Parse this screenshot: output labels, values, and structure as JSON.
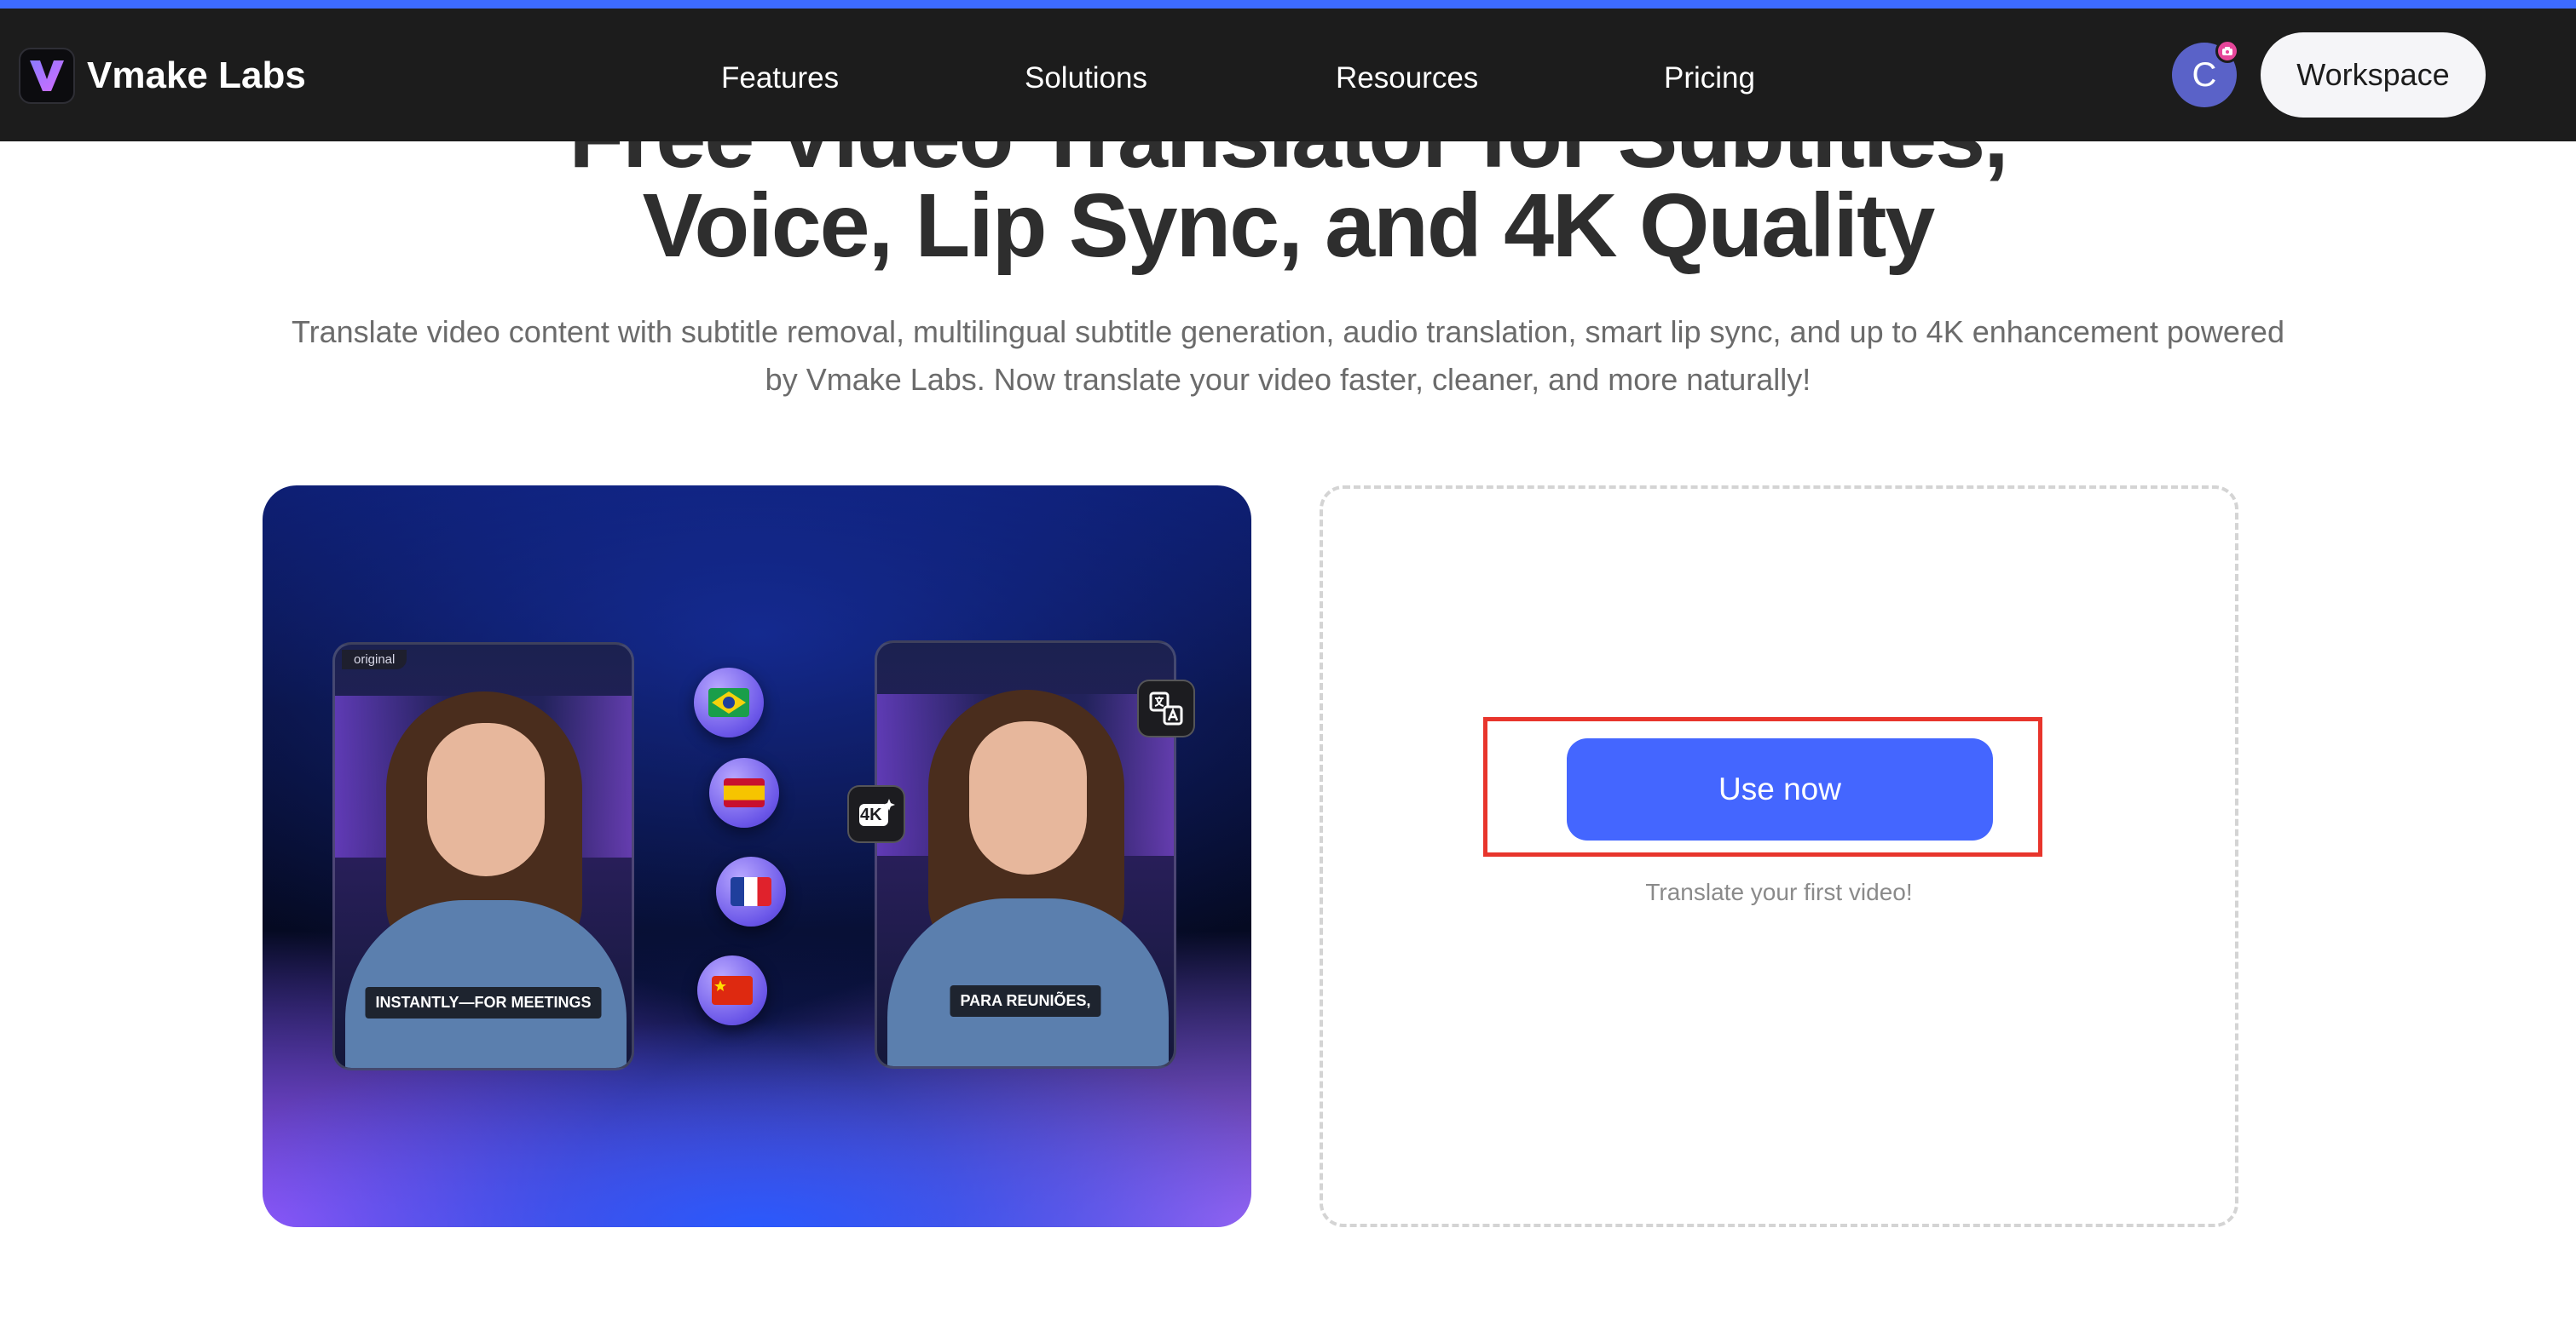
{
  "brand": {
    "name": "Vmake Labs",
    "accent_color": "#3d6bff",
    "button_color": "#4466ff"
  },
  "nav": {
    "links": [
      "Features",
      "Solutions",
      "Resources",
      "Pricing"
    ],
    "avatar_letter": "C",
    "workspace_label": "Workspace"
  },
  "hero": {
    "title_line1": "Free Video Translator for Subtitles,",
    "title_line2": "Voice, Lip Sync, and 4K Quality",
    "subtitle": "Translate video content with subtitle removal, multilingual subtitle generation, audio translation, smart lip sync, and up to 4K enhancement powered by Vmake Labs. Now translate your video faster, cleaner, and more naturally!"
  },
  "demo": {
    "original_tag": "original",
    "caption_original": "INSTANTLY—FOR MEETINGS",
    "caption_translated": "PARA REUNIÕES,",
    "quality_chip": "4K",
    "flags": [
      "brazil-flag-icon",
      "spain-flag-icon",
      "france-flag-icon",
      "china-flag-icon"
    ]
  },
  "cta": {
    "button_label": "Use now",
    "hint": "Translate your first video!",
    "highlight_color": "#e8352c"
  }
}
